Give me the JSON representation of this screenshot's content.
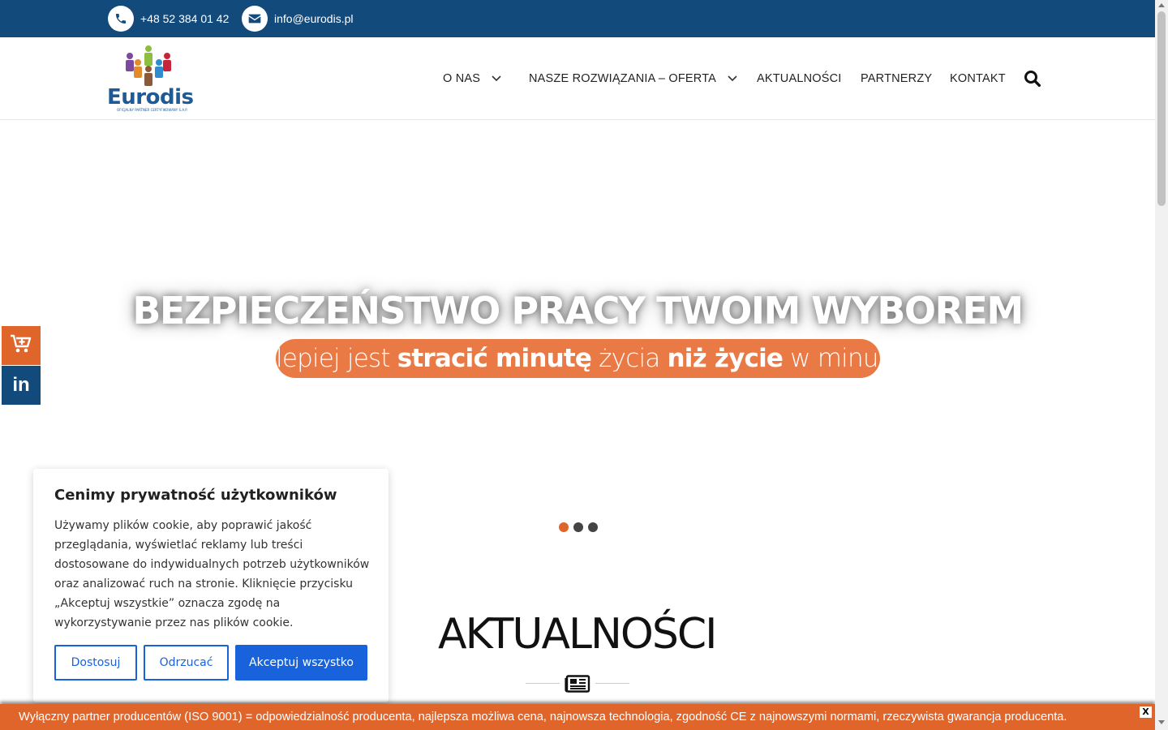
{
  "topbar": {
    "phone": "+48 52 384 01 42",
    "email": "info@eurodis.pl",
    "background_color": "#134a7c",
    "phone_icon": "phone-icon",
    "email_icon": "envelope-icon"
  },
  "header": {
    "logo_text": "Eurodis",
    "logo_tagline": "OFICJALNY PARTNER CERTYFIKOWANY S.A.P.",
    "nav": [
      {
        "label": "O NAS",
        "has_dropdown": true
      },
      {
        "label": "NASZE ROZWIĄZANIA – OFERTA",
        "has_dropdown": true
      },
      {
        "label": "AKTUALNOŚCI",
        "has_dropdown": false
      },
      {
        "label": "PARTNERZY",
        "has_dropdown": false
      },
      {
        "label": "KONTAKT",
        "has_dropdown": false
      }
    ],
    "search_icon": "search-icon"
  },
  "hero": {
    "title": "BEZPIECZEŃSTWO PRACY TWOIM WYBOREM",
    "subtitle_parts": {
      "p1": "lepiej jest ",
      "b1": "stracić minutę",
      "p2": " życia ",
      "b2": "niż życie",
      "p3": " w minutę"
    },
    "slides_total": 3,
    "active_slide": 1,
    "accent_color": "#ea7a45"
  },
  "side_buttons": {
    "cart_icon": "cart-plus-icon",
    "linkedin_label": "in"
  },
  "news": {
    "title": "AKTUALNOŚCI",
    "icon": "newspaper-icon"
  },
  "cookie": {
    "title": "Cenimy prywatność użytkowników",
    "text": "Używamy plików cookie, aby poprawić jakość przeglądania, wyświetlać reklamy lub treści dostosowane do indywidualnych potrzeb użytkowników oraz analizować ruch na stronie. Kliknięcie przycisku „Akceptuj wszystkie” oznacza zgodę na wykorzystywanie przez nas plików cookie.",
    "customize_label": "Dostosuj",
    "reject_label": "Odrzucać",
    "accept_label": "Akceptuj wszystko",
    "button_color": "#1863dc"
  },
  "bottom_bar": {
    "text": "Wyłączny partner producentów (ISO 9001) = odpowiedzialność producenta, najlepsza możliwa cena, najnowsza technologia, zgodność CE z najnowszymi normami, rzeczywista gwarancja producenta.",
    "close_label": "X",
    "background_color": "#e0652b"
  }
}
